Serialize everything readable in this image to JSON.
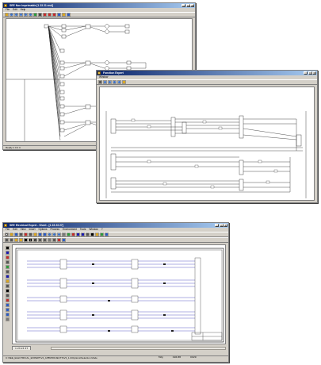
{
  "win1": {
    "title": "SEE Non Imprimable [1 23 21 end]",
    "menu": [
      "File",
      "Edit",
      "Help"
    ],
    "status": "Ready 1 0 2 3"
  },
  "win2": {
    "title": "Fonction Expert",
    "menu": [
      "Window"
    ]
  },
  "win3": {
    "title": "SEE Electrical Expert - Sheet - [1 23 23 27]",
    "menu": [
      "File",
      "Edit",
      "View",
      "Insert",
      "Options",
      "Process",
      "Environment",
      "Tools",
      "Window",
      "?"
    ],
    "tab_label": "1 23 23 37",
    "status": {
      "path": "C:\\SEE_ELECTRICAL_EXPERT\\V4_APB\\PROJECTS\\V3_1-3\\Options\\Selection Mode",
      "mode": "MAJ",
      "zoom": "196.88",
      "code": "0029"
    }
  },
  "colors": {
    "titlebar": "#0a246a",
    "wire": "#1a1ab0",
    "chrome": "#d4d0c8"
  }
}
